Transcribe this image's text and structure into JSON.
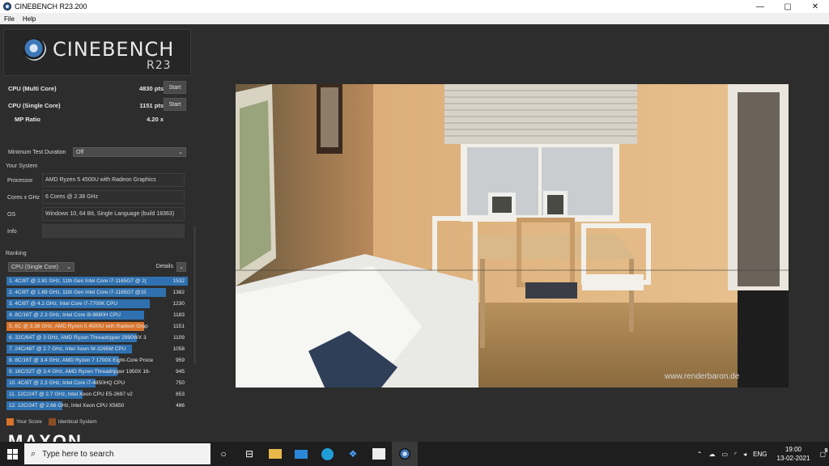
{
  "window": {
    "title": "CINEBENCH R23.200"
  },
  "menu": [
    "File",
    "Help"
  ],
  "window_controls": {
    "minimize": "—",
    "maximize": "▢",
    "close": "✕"
  },
  "logo": {
    "name": "CINEBENCH",
    "version": "R23"
  },
  "scores": {
    "multi": {
      "label": "CPU (Multi Core)",
      "value": "4830 pts",
      "button": "Start"
    },
    "single": {
      "label": "CPU (Single Core)",
      "value": "1151 pts",
      "button": "Start"
    },
    "ratio": {
      "label": "MP Ratio",
      "value": "4.20 x"
    }
  },
  "min_test": {
    "label": "Minimum Test Duration",
    "value": "Off"
  },
  "your_system": {
    "title": "Your System",
    "rows": [
      {
        "label": "Processor",
        "value": "AMD Ryzen 5 4500U with Radeon Graphics"
      },
      {
        "label": "Cores x GHz",
        "value": "6 Cores @ 2.38 GHz"
      },
      {
        "label": "OS",
        "value": "Windows 10, 64 Bit, Single Language (build 18363)"
      },
      {
        "label": "Info",
        "value": ""
      }
    ]
  },
  "ranking": {
    "title": "Ranking",
    "selector": "CPU (Single Core)",
    "details": "Details",
    "items": [
      {
        "text": "1. 4C/8T @ 2.81 GHz, 11th Gen Intel Core i7-1165G7 @ 2(",
        "score": "1532",
        "fraction": 1.0,
        "you": false
      },
      {
        "text": "2. 4C/8T @ 1.69 GHz, 11th Gen Intel Core i7-1165G7 @15",
        "score": "1382",
        "fraction": 0.88,
        "you": false
      },
      {
        "text": "3. 4C/8T @ 4.2 GHz, Intel Core i7-7700K CPU",
        "score": "1230",
        "fraction": 0.79,
        "you": false
      },
      {
        "text": "4. 8C/16T @ 2.3 GHz, Intel Core i9-9880H CPU",
        "score": "1183",
        "fraction": 0.76,
        "you": false
      },
      {
        "text": "5. 6C @ 3.38 GHz, AMD Ryzen 5 4500U with Radeon Grap",
        "score": "1151",
        "fraction": 0.76,
        "you": true
      },
      {
        "text": "6. 32C/64T @ 3 GHz, AMD Ryzen Threadripper 2990WX 3",
        "score": "1109",
        "fraction": 0.72,
        "you": false
      },
      {
        "text": "7. 24C/48T @ 2.7 GHz, Intel Xeon W-3265M CPU",
        "score": "1058",
        "fraction": 0.69,
        "you": false
      },
      {
        "text": "8. 8C/16T @ 3.4 GHz, AMD Ryzen 7 1700X Eight-Core Proce",
        "score": "959",
        "fraction": 0.62,
        "you": false
      },
      {
        "text": "9. 16C/32T @ 3.4 GHz, AMD Ryzen Threadripper 1950X 16-",
        "score": "945",
        "fraction": 0.61,
        "you": false
      },
      {
        "text": "10. 4C/8T @ 2.3 GHz, Intel Core i7-4850HQ CPU",
        "score": "750",
        "fraction": 0.49,
        "you": false
      },
      {
        "text": "11. 12C/24T @ 2.7 GHz, Intel Xeon CPU E5-2697 v2",
        "score": "653",
        "fraction": 0.42,
        "you": false
      },
      {
        "text": "12. 12C/24T @ 2.66 GHz, Intel Xeon CPU X5650",
        "score": "486",
        "fraction": 0.31,
        "you": false
      }
    ]
  },
  "legend": {
    "your_score": "Your Score",
    "identical": "Identical System"
  },
  "brand": "MAXON",
  "render": {
    "watermark": "www.renderbaron.de"
  },
  "taskbar": {
    "search_placeholder": "Type here to search",
    "language": "ENG",
    "time": "19:00",
    "date": "13-02-2021",
    "notifications": "9"
  },
  "colors": {
    "accent_blue": "#2f71b0",
    "your_score_orange": "#d8732b",
    "identical_brown": "#8a4d22"
  }
}
